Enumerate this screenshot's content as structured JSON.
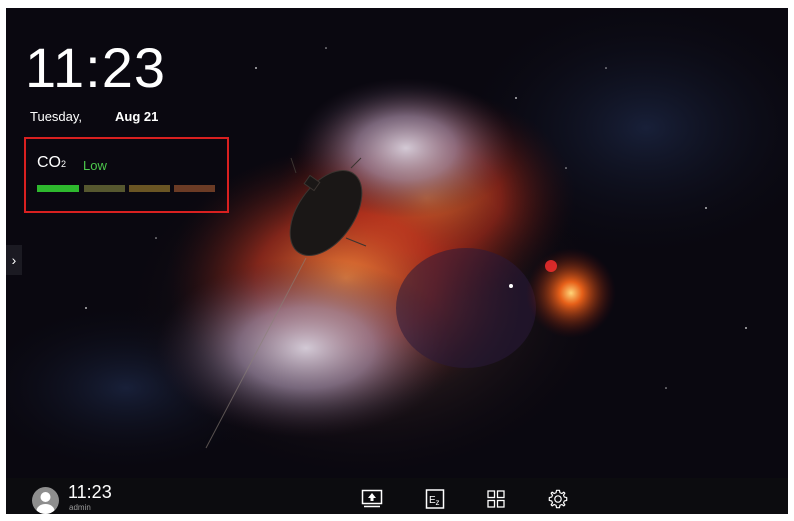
{
  "home": {
    "clock": "11:23",
    "weekday": "Tuesday,",
    "date": "Aug 21"
  },
  "co2": {
    "label_main": "CO",
    "label_sub": "2",
    "level": "Low",
    "level_color": "#4cc84c",
    "highlight_color": "#d92020",
    "segments": [
      {
        "color": "#2eb82e",
        "active": true
      },
      {
        "color": "#56572f",
        "active": false
      },
      {
        "color": "#6a5524",
        "active": false
      },
      {
        "color": "#6b3b25",
        "active": false
      }
    ]
  },
  "side_panel": {
    "toggle_icon": "chevron-right-icon",
    "glyph": "›"
  },
  "taskbar": {
    "clock": "11:23",
    "user": "admin",
    "icons": [
      "screen-share-icon",
      "ez-write-icon",
      "apps-grid-icon",
      "settings-gear-icon"
    ]
  },
  "wallpaper": {
    "subject": "space-probe-nebula"
  }
}
